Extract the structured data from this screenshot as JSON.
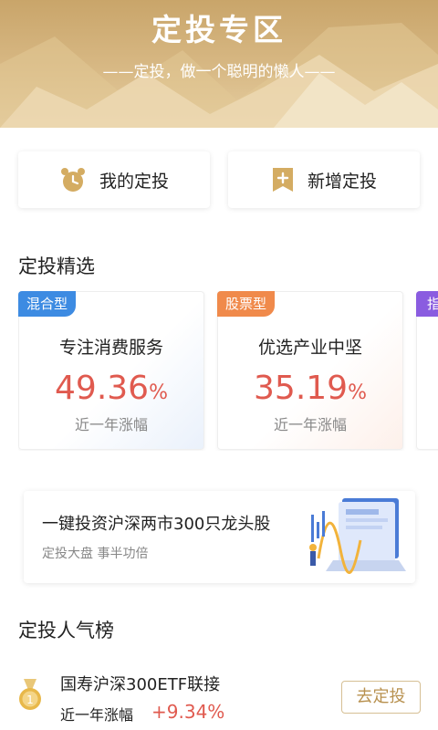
{
  "hero": {
    "title": "定投专区",
    "slogan": "——定投，做一个聪明的懒人——"
  },
  "actions": {
    "my_plan_label": "我的定投",
    "new_plan_label": "新增定投"
  },
  "featured": {
    "title": "定投精选",
    "cards": [
      {
        "tag": "混合型",
        "tag_color": "#3d8be2",
        "name": "专注消费服务",
        "return": "49.36",
        "unit": "%",
        "period": "近一年涨幅"
      },
      {
        "tag": "股票型",
        "tag_color": "#f08a4b",
        "name": "优选产业中坚",
        "return": "35.19",
        "unit": "%",
        "period": "近一年涨幅"
      },
      {
        "tag": "指数",
        "tag_color": "#8a5ce0"
      }
    ]
  },
  "banner": {
    "title": "一键投资沪深两市300只龙头股",
    "subtitle": "定投大盘 事半功倍"
  },
  "ranking": {
    "title": "定投人气榜",
    "items": [
      {
        "rank": "1",
        "name": "国寿沪深300ETF联接",
        "period": "近一年涨幅",
        "change": "+9.34%",
        "action_label": "去定投"
      }
    ]
  },
  "colors": {
    "gold": "#c9a56a",
    "up_red": "#e05a4f"
  }
}
